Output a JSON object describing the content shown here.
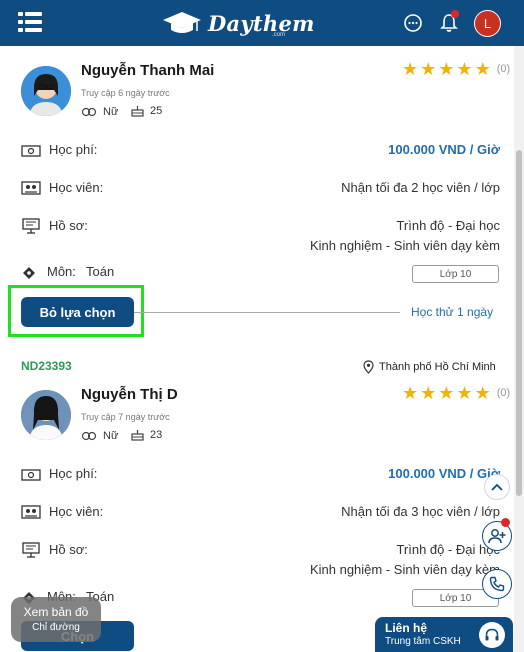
{
  "header": {
    "logo_text": "Daythem",
    "logo_sub": ".com",
    "avatar_initial": "L"
  },
  "tutors": [
    {
      "code": "",
      "location": "",
      "name": "Nguyễn Thanh Mai",
      "access": "Truy cập 6 ngày trước",
      "gender": "Nữ",
      "age": "25",
      "rating_count": "(0)",
      "stars": 5,
      "fee_label": "Học phí:",
      "fee_value": "100.000 VND / Giờ",
      "students_label": "Học viên:",
      "students_value": "Nhận tối đa 2 học viên / lớp",
      "profile_label": "Hồ sơ:",
      "profile_level": "Trình độ - Đại học",
      "profile_exp": "Kinh nghiệm - Sinh viên dạy kèm",
      "subject_label": "Môn:",
      "subject_value": "Toán",
      "grade": "Lớp 10",
      "button": "Bỏ lựa chọn",
      "trial": "Học thử 1 ngày"
    },
    {
      "code": "ND23393",
      "location": "Thành phố Hồ Chí Minh",
      "name": "Nguyễn Thị D",
      "access": "Truy cập 7 ngày trước",
      "gender": "Nữ",
      "age": "23",
      "rating_count": "(0)",
      "stars": 5,
      "fee_label": "Học phí:",
      "fee_value": "100.000 VND / Giờ",
      "students_label": "Học viên:",
      "students_value": "Nhận tối đa 3 học viên / lớp",
      "profile_label": "Hồ sơ:",
      "profile_level": "Trình độ - Đại học",
      "profile_exp": "Kinh nghiệm - Sinh viên dạy kèm",
      "subject_label": "Môn:",
      "subject_value": "Toán",
      "grade": "Lớp 10",
      "button": "Chọn"
    }
  ],
  "map_button": {
    "line1": "Xem bản đồ",
    "line2": "Chỉ đường"
  },
  "contact": {
    "line1": "Liên hệ",
    "line2": "Trung tâm CSKH"
  },
  "colors": {
    "primary": "#0f4c81",
    "price": "#1f6eb0",
    "code": "#2e9a59",
    "star": "#f5b301",
    "highlight": "#22e01f"
  }
}
